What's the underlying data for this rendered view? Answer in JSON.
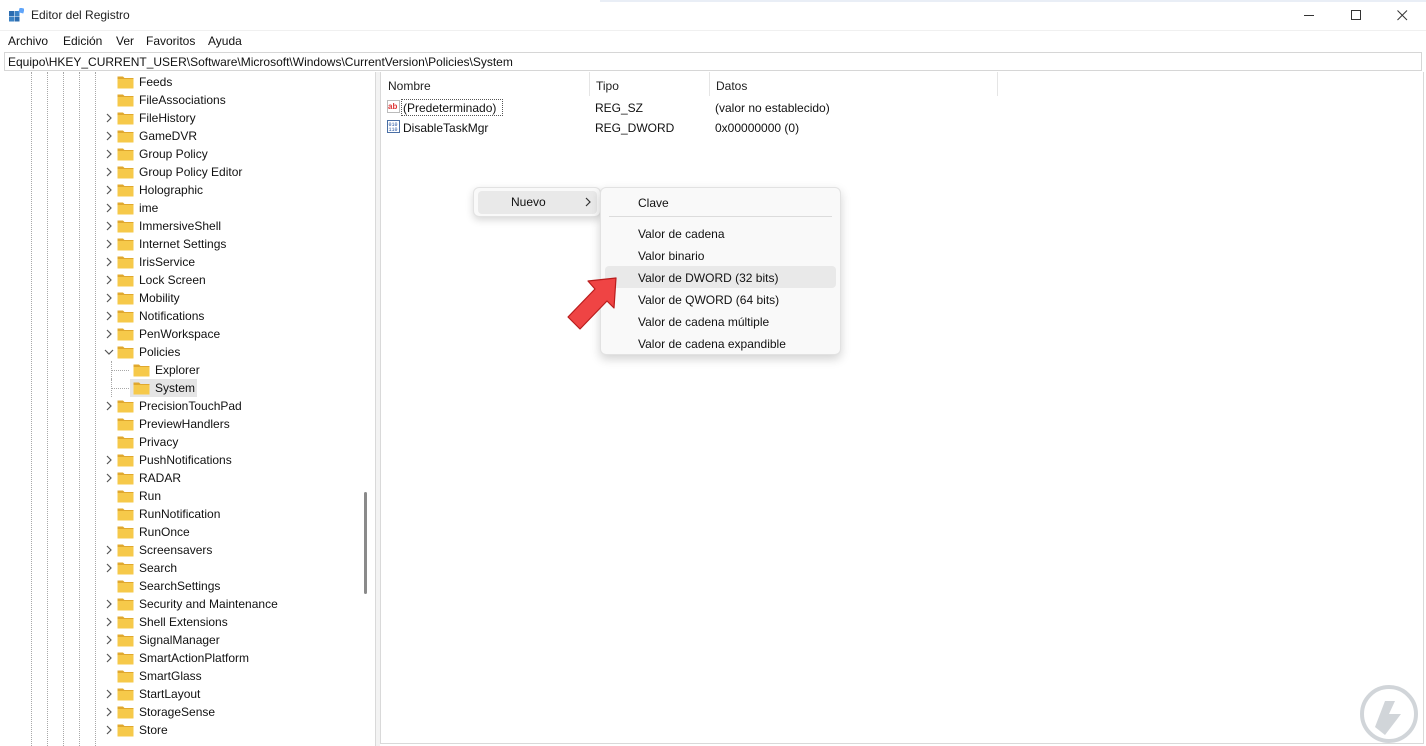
{
  "window": {
    "title": "Editor del Registro",
    "controls": [
      "minimize",
      "maximize",
      "close"
    ]
  },
  "menu": {
    "items": [
      "Archivo",
      "Edición",
      "Ver",
      "Favoritos",
      "Ayuda"
    ]
  },
  "address": {
    "path": "Equipo\\HKEY_CURRENT_USER\\Software\\Microsoft\\Windows\\CurrentVersion\\Policies\\System"
  },
  "tree": {
    "items": [
      {
        "label": "Feeds",
        "expandable": false
      },
      {
        "label": "FileAssociations",
        "expandable": false
      },
      {
        "label": "FileHistory",
        "expandable": true
      },
      {
        "label": "GameDVR",
        "expandable": true
      },
      {
        "label": "Group Policy",
        "expandable": true
      },
      {
        "label": "Group Policy Editor",
        "expandable": true
      },
      {
        "label": "Holographic",
        "expandable": true
      },
      {
        "label": "ime",
        "expandable": true
      },
      {
        "label": "ImmersiveShell",
        "expandable": true
      },
      {
        "label": "Internet Settings",
        "expandable": true
      },
      {
        "label": "IrisService",
        "expandable": true
      },
      {
        "label": "Lock Screen",
        "expandable": true
      },
      {
        "label": "Mobility",
        "expandable": true
      },
      {
        "label": "Notifications",
        "expandable": true
      },
      {
        "label": "PenWorkspace",
        "expandable": true
      },
      {
        "label": "Policies",
        "expandable": true,
        "expanded": true
      },
      {
        "label": "Explorer",
        "expandable": false,
        "child": true
      },
      {
        "label": "System",
        "expandable": false,
        "child": true,
        "selected": true
      },
      {
        "label": "PrecisionTouchPad",
        "expandable": true
      },
      {
        "label": "PreviewHandlers",
        "expandable": false
      },
      {
        "label": "Privacy",
        "expandable": false
      },
      {
        "label": "PushNotifications",
        "expandable": true
      },
      {
        "label": "RADAR",
        "expandable": true
      },
      {
        "label": "Run",
        "expandable": false
      },
      {
        "label": "RunNotification",
        "expandable": false
      },
      {
        "label": "RunOnce",
        "expandable": false
      },
      {
        "label": "Screensavers",
        "expandable": true
      },
      {
        "label": "Search",
        "expandable": true
      },
      {
        "label": "SearchSettings",
        "expandable": false
      },
      {
        "label": "Security and Maintenance",
        "expandable": true
      },
      {
        "label": "Shell Extensions",
        "expandable": true
      },
      {
        "label": "SignalManager",
        "expandable": true
      },
      {
        "label": "SmartActionPlatform",
        "expandable": true
      },
      {
        "label": "SmartGlass",
        "expandable": false
      },
      {
        "label": "StartLayout",
        "expandable": true
      },
      {
        "label": "StorageSense",
        "expandable": true
      },
      {
        "label": "Store",
        "expandable": true
      }
    ]
  },
  "list": {
    "columns": {
      "name": "Nombre",
      "type": "Tipo",
      "data": "Datos"
    },
    "rows": [
      {
        "icon": "string-value-icon",
        "name": "(Predeterminado)",
        "type": "REG_SZ",
        "data": "(valor no establecido)"
      },
      {
        "icon": "binary-value-icon",
        "name": "DisableTaskMgr",
        "type": "REG_DWORD",
        "data": "0x00000000 (0)"
      }
    ]
  },
  "context_menu": {
    "parent_label": "Nuevo",
    "submenu": {
      "items": [
        "Clave",
        "Valor de cadena",
        "Valor binario",
        "Valor de DWORD (32 bits)",
        "Valor de QWORD (64 bits)",
        "Valor de cadena múltiple",
        "Valor de cadena expandible"
      ],
      "highlighted": "Valor de DWORD (32 bits)"
    }
  },
  "colors": {
    "folder": "#f6c94a",
    "folder_dark": "#e0a82e",
    "accent_arrow": "#ef4444",
    "selection": "#e5e5e5",
    "menu_hover": "#e9e9e9"
  }
}
